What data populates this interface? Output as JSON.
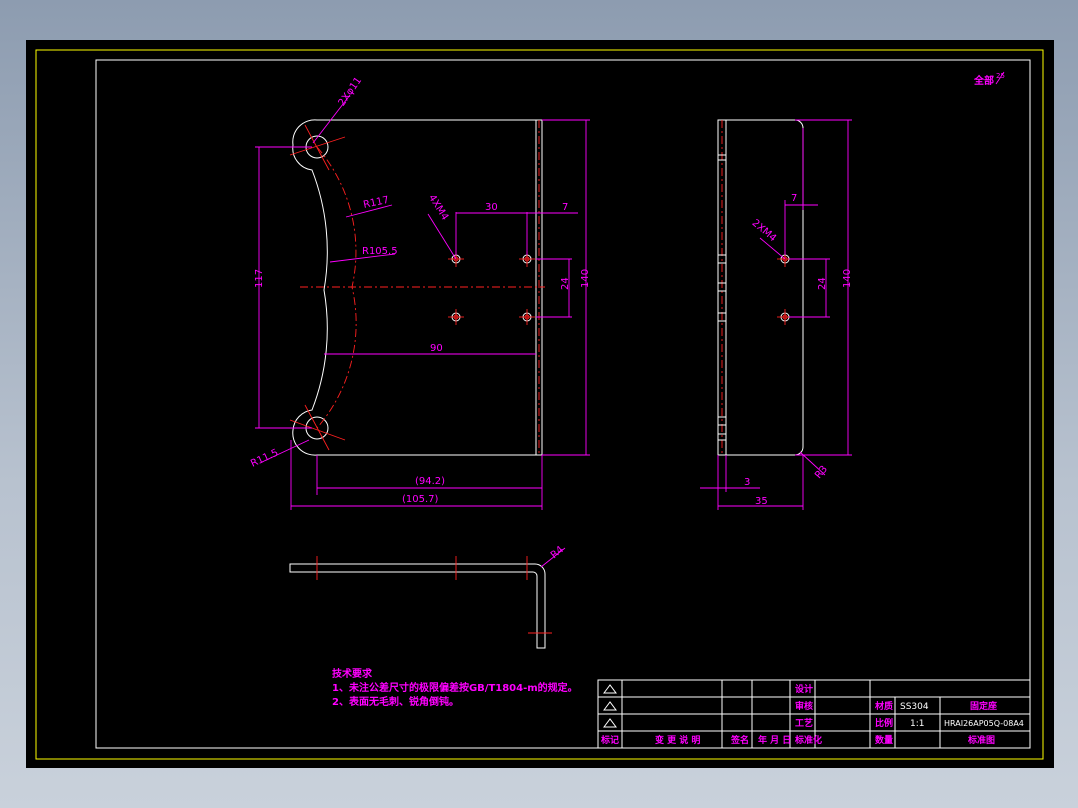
{
  "drawing": {
    "view_label": "全部",
    "view_label_sup": "25",
    "front": {
      "holes_label": "2Xφ11",
      "r117": "R117",
      "r105": "R105.5",
      "r11": "R11.5",
      "tap_label": "4XM4",
      "dim_30": "30",
      "dim_7": "7",
      "dim_24": "24",
      "dim_140": "140",
      "dim_117": "117",
      "dim_90": "90",
      "dim_942": "(94.2)",
      "dim_1057": "(105.7)"
    },
    "side": {
      "dim_7": "7",
      "tap_label": "2XM4",
      "dim_24": "24",
      "dim_140": "140",
      "r3": "R3",
      "dim_3": "3",
      "dim_35": "35"
    },
    "top": {
      "r4": "R4"
    },
    "notes": {
      "title": "技术要求",
      "line1": "1、未注公差尺寸的极限偏差按GB/T1804-m的规定。",
      "line2": "2、表面无毛刺、锐角倒钝。"
    },
    "title_block": {
      "design": "设计",
      "review": "审核",
      "process": "工艺",
      "material_label": "材质",
      "material": "SS304",
      "part_name": "固定座",
      "scale_label": "比例",
      "scale": "1:1",
      "drawing_no": "HRAI26AP05Q-08A4",
      "qty_label": "数量",
      "standard_label": "标准图",
      "rev_mark": "标记",
      "change_desc": "变 更 说 明",
      "signature": "签名",
      "date": "年 月 日",
      "standardize": "标准化"
    }
  }
}
